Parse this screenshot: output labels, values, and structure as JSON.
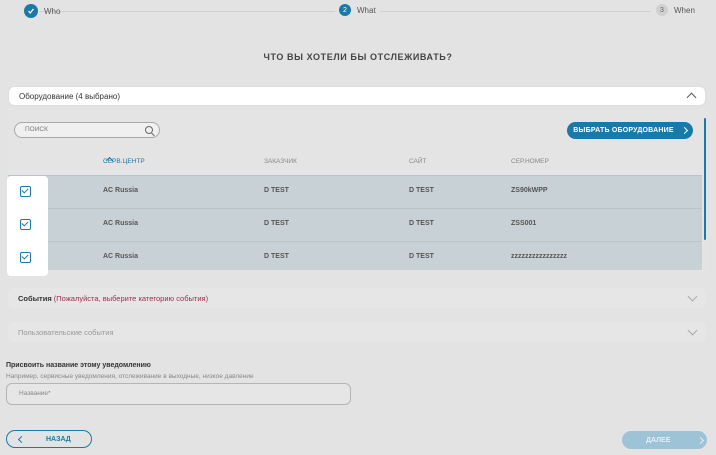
{
  "stepper": {
    "steps": [
      {
        "label": "Who",
        "number": "",
        "state": "done"
      },
      {
        "label": "What",
        "number": "2",
        "state": "active"
      },
      {
        "label": "When",
        "number": "3",
        "state": "todo"
      }
    ]
  },
  "title": "ЧТО ВЫ ХОТЕЛИ БЫ ОТСЛЕЖИВАТЬ?",
  "equipment": {
    "header": "Оборудование (4 выбрано)",
    "search_placeholder": "ПОИСК",
    "select_button": "ВЫБРАТЬ ОБОРУДОВАНИЕ",
    "columns": [
      "СЕРВ.ЦЕНТР",
      "ЗАКАЗЧИК",
      "САЙТ",
      "СЕР.НОМЕР"
    ],
    "rows": [
      {
        "center": "AC Russia",
        "customer": "D TEST",
        "site": "D TEST",
        "serial": "ZS90kWPP",
        "checked": true
      },
      {
        "center": "AC Russia",
        "customer": "D TEST",
        "site": "D TEST",
        "serial": "ZSS001",
        "checked": true
      },
      {
        "center": "AC Russia",
        "customer": "D TEST",
        "site": "D TEST",
        "serial": "zzzzzzzzzzzzzzzz",
        "checked": true
      }
    ]
  },
  "events": {
    "label": "События",
    "warning": "(Пожалуйста, выберите категорию события)"
  },
  "custom_events": {
    "label": "Пользовательские события"
  },
  "notification_name": {
    "title": "Присвоить название этому уведомлению",
    "hint": "Например, сервисные уведомления, отслеживание в выходные, низкое давление",
    "placeholder": "Название*"
  },
  "footer": {
    "back": "НАЗАД",
    "next": "ДАЛЕЕ"
  },
  "colors": {
    "accent": "#1a79a6",
    "warning": "#a32b4e"
  }
}
